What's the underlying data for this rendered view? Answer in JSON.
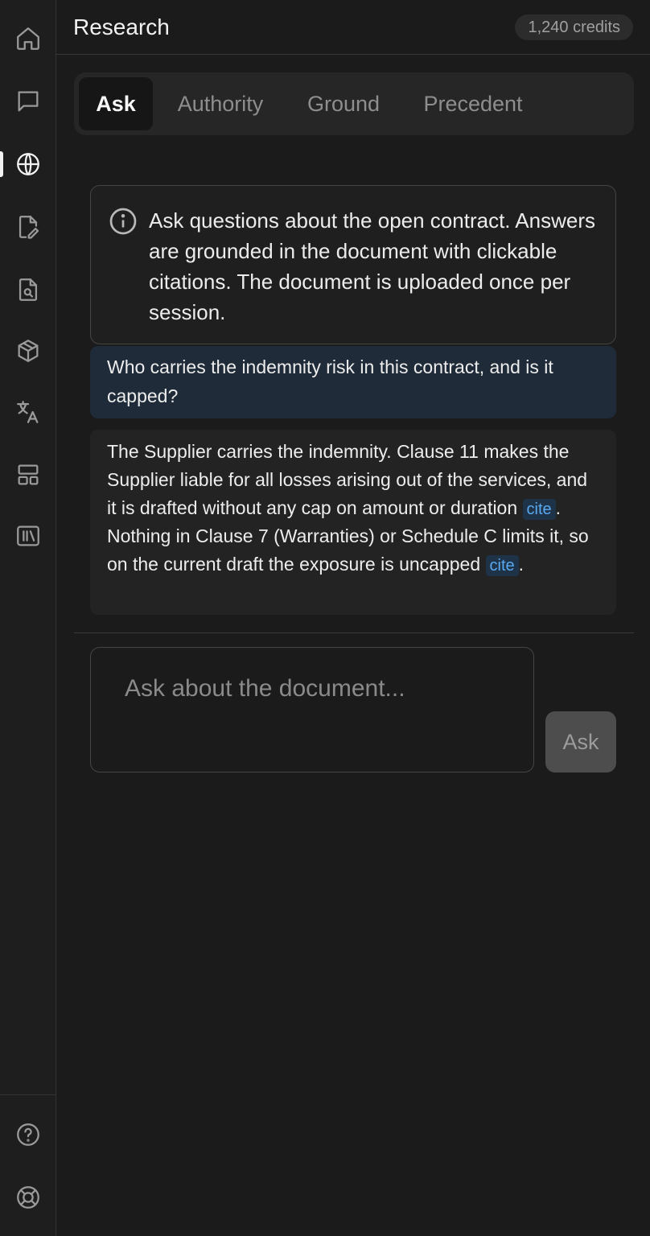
{
  "header": {
    "title": "Research",
    "credits": "1,240 credits"
  },
  "sidebar": {
    "items": [
      {
        "icon": "home-icon"
      },
      {
        "icon": "chat-icon"
      },
      {
        "icon": "globe-icon",
        "active": true
      },
      {
        "icon": "file-edit-icon"
      },
      {
        "icon": "file-search-icon"
      },
      {
        "icon": "cube-icon"
      },
      {
        "icon": "translate-icon"
      },
      {
        "icon": "layout-icon"
      },
      {
        "icon": "library-icon"
      }
    ],
    "bottom": [
      {
        "icon": "help-icon"
      },
      {
        "icon": "support-icon"
      }
    ]
  },
  "tabs": [
    {
      "label": "Ask",
      "active": true
    },
    {
      "label": "Authority"
    },
    {
      "label": "Ground"
    },
    {
      "label": "Precedent"
    }
  ],
  "info": {
    "text": "Ask questions about the open contract. Answers are grounded in the document with clickable citations. The document is uploaded once per session."
  },
  "messages": {
    "user": "Who carries the indemnity risk in this contract, and is it capped?",
    "assistant": {
      "part1": "The Supplier carries the indemnity. Clause 11 makes the Supplier liable for all losses arising out of the services, and it is drafted without any cap on amount or duration",
      "cite1": "cite",
      "part2": ". Nothing in Clause 7 (Warranties) or Schedule C limits it, so on the current draft the exposure is uncapped",
      "cite2": "cite",
      "part3": "."
    }
  },
  "composer": {
    "placeholder": "Ask about the document...",
    "button_label": "Ask"
  }
}
